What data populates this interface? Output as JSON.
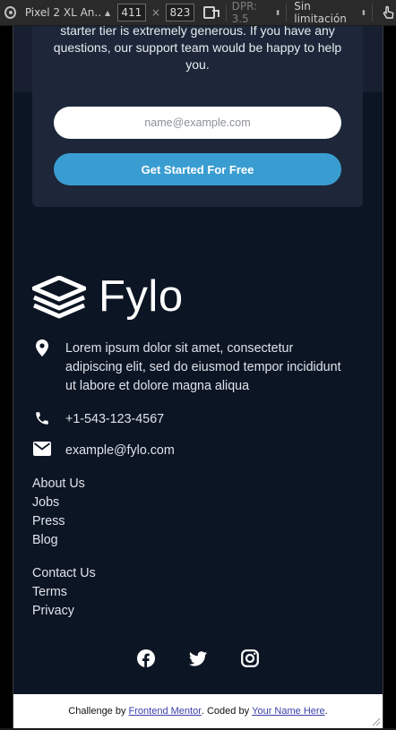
{
  "devtools": {
    "device": "Pixel 2 XL An...",
    "width": "411",
    "height": "823",
    "times": "×",
    "dpr": "DPR: 3.5",
    "throttling": "Sin limitación"
  },
  "cta_section": {
    "text": "starter tier is extremely generous. If you have any questions, our support team would be happy to help you.",
    "email_placeholder": "name@example.com",
    "button_label": "Get Started For Free"
  },
  "footer": {
    "logo_text": "Fylo",
    "address": "Lorem ipsum dolor sit amet, consectetur adipiscing elit, sed do eiusmod tempor incididunt ut labore et dolore magna aliqua",
    "phone": "+1-543-123-4567",
    "email": "example@fylo.com",
    "links_group_1": [
      "About Us",
      "Jobs",
      "Press",
      "Blog"
    ],
    "links_group_2": [
      "Contact Us",
      "Terms",
      "Privacy"
    ],
    "social": [
      "facebook-icon",
      "twitter-icon",
      "instagram-icon"
    ]
  },
  "attribution": {
    "prefix": "Challenge by ",
    "link1": "Frontend Mentor",
    "middle": ". Coded by ",
    "link2": "Your Name Here",
    "suffix": "."
  }
}
